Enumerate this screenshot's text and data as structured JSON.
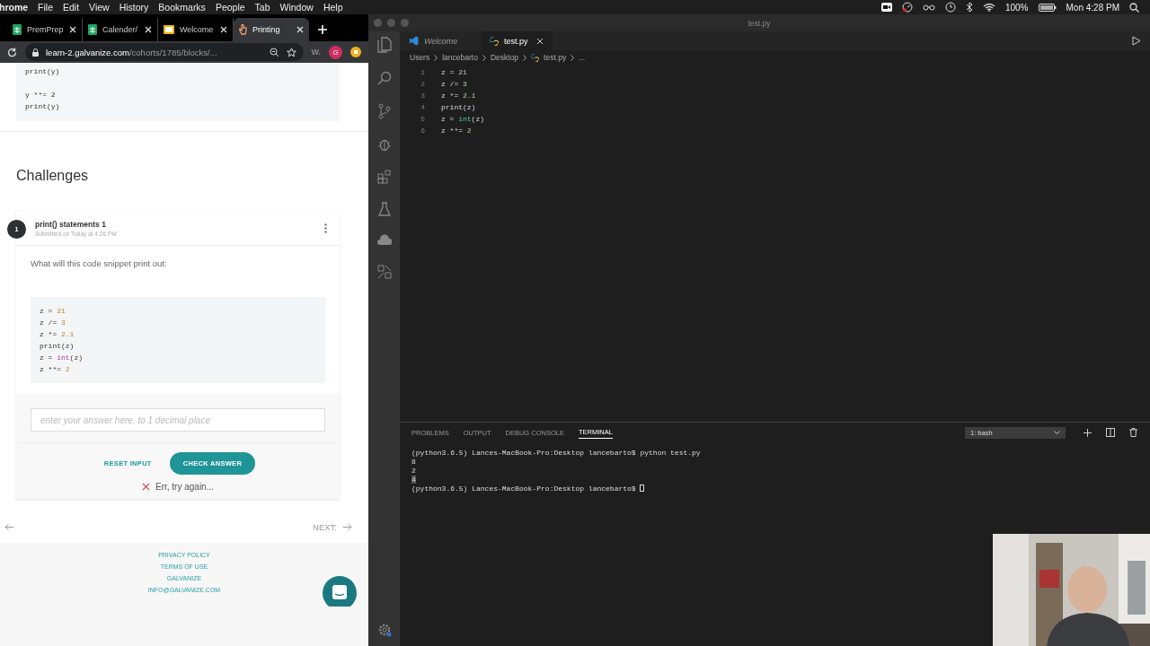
{
  "menubar": {
    "app": "hrome",
    "menus": [
      "File",
      "Edit",
      "View",
      "History",
      "Bookmarks",
      "People",
      "Tab",
      "Window",
      "Help"
    ],
    "battery": "100%",
    "clock": "Mon 4:28 PM"
  },
  "browser": {
    "tabs": [
      {
        "title": "PremPrep",
        "kind": "sheet",
        "selected": false
      },
      {
        "title": "Calender/",
        "kind": "sheet",
        "selected": false
      },
      {
        "title": "Welcome",
        "kind": "slides",
        "selected": false
      },
      {
        "title": "Printing",
        "kind": "page",
        "selected": true
      }
    ],
    "address": {
      "host": "learn-2.galvanize.com",
      "path": "/cohorts/1785/blocks/..."
    },
    "extension": "W.",
    "profile": "G"
  },
  "page": {
    "top_code": [
      [
        "print(y)"
      ],
      [
        "y **= 2",
        "print(y)"
      ]
    ],
    "heading": "Challenges",
    "challenge": {
      "number": "1",
      "title": "print() statements 1",
      "meta": "Submitted on Today at 4:26 PM",
      "question": "What will this code snippet print out:",
      "code": [
        "z = 21",
        "z /= 3",
        "z *= 2.1",
        "print(z)",
        "z = int(z)",
        "z **= 2"
      ],
      "answer": {
        "placeholder": "enter your answer here, to 1 decimal place"
      },
      "reset": "RESET INPUT",
      "check": "CHECK ANSWER",
      "feedback": {
        "kind": "error",
        "text": "Err, try again..."
      }
    },
    "next": "NEXT:",
    "footer": [
      "PRIVACY POLICY",
      "TERMS OF USE",
      "GALVANIZE",
      "INFO@GALVANIZE.COM"
    ]
  },
  "editor": {
    "title": "test.py",
    "tabs": [
      {
        "title": "Welcome",
        "kind": "welcome",
        "selected": false
      },
      {
        "title": "test.py",
        "kind": "python",
        "selected": true
      }
    ],
    "breadcrumb": [
      "Users",
      "lancebarto",
      "Desktop",
      "test.py",
      "..."
    ],
    "lines": [
      {
        "number": "1",
        "text": "z = 21"
      },
      {
        "number": "2",
        "text": "z /= 3"
      },
      {
        "number": "3",
        "text": "z *= 2.1"
      },
      {
        "number": "4",
        "text": "print(z)"
      },
      {
        "number": "5",
        "text": "z = int(z)"
      },
      {
        "number": "6",
        "text": "z **= 2"
      }
    ],
    "panel_tabs": [
      {
        "label": "PROBLEMS",
        "selected": false
      },
      {
        "label": "OUTPUT",
        "selected": false
      },
      {
        "label": "DEBUG CONSOLE",
        "selected": false
      },
      {
        "label": "TERMINAL",
        "selected": true
      }
    ],
    "terminal_select": "1: bash",
    "terminal": [
      {
        "text": "(python3.6.5) Lances-MacBook-Pro:Desktop lancebarto$ python test.py",
        "highlighted": false,
        "cursor": false
      },
      {
        "text": "8",
        "highlighted": false,
        "cursor": false
      },
      {
        "text": "2",
        "highlighted": false,
        "cursor": false
      },
      {
        "text": "4",
        "highlighted": true,
        "cursor": false
      },
      {
        "text": "(python3.6.5) Lances-MacBook-Pro:Desktop lancebarto$",
        "highlighted": false,
        "cursor": true
      }
    ]
  }
}
